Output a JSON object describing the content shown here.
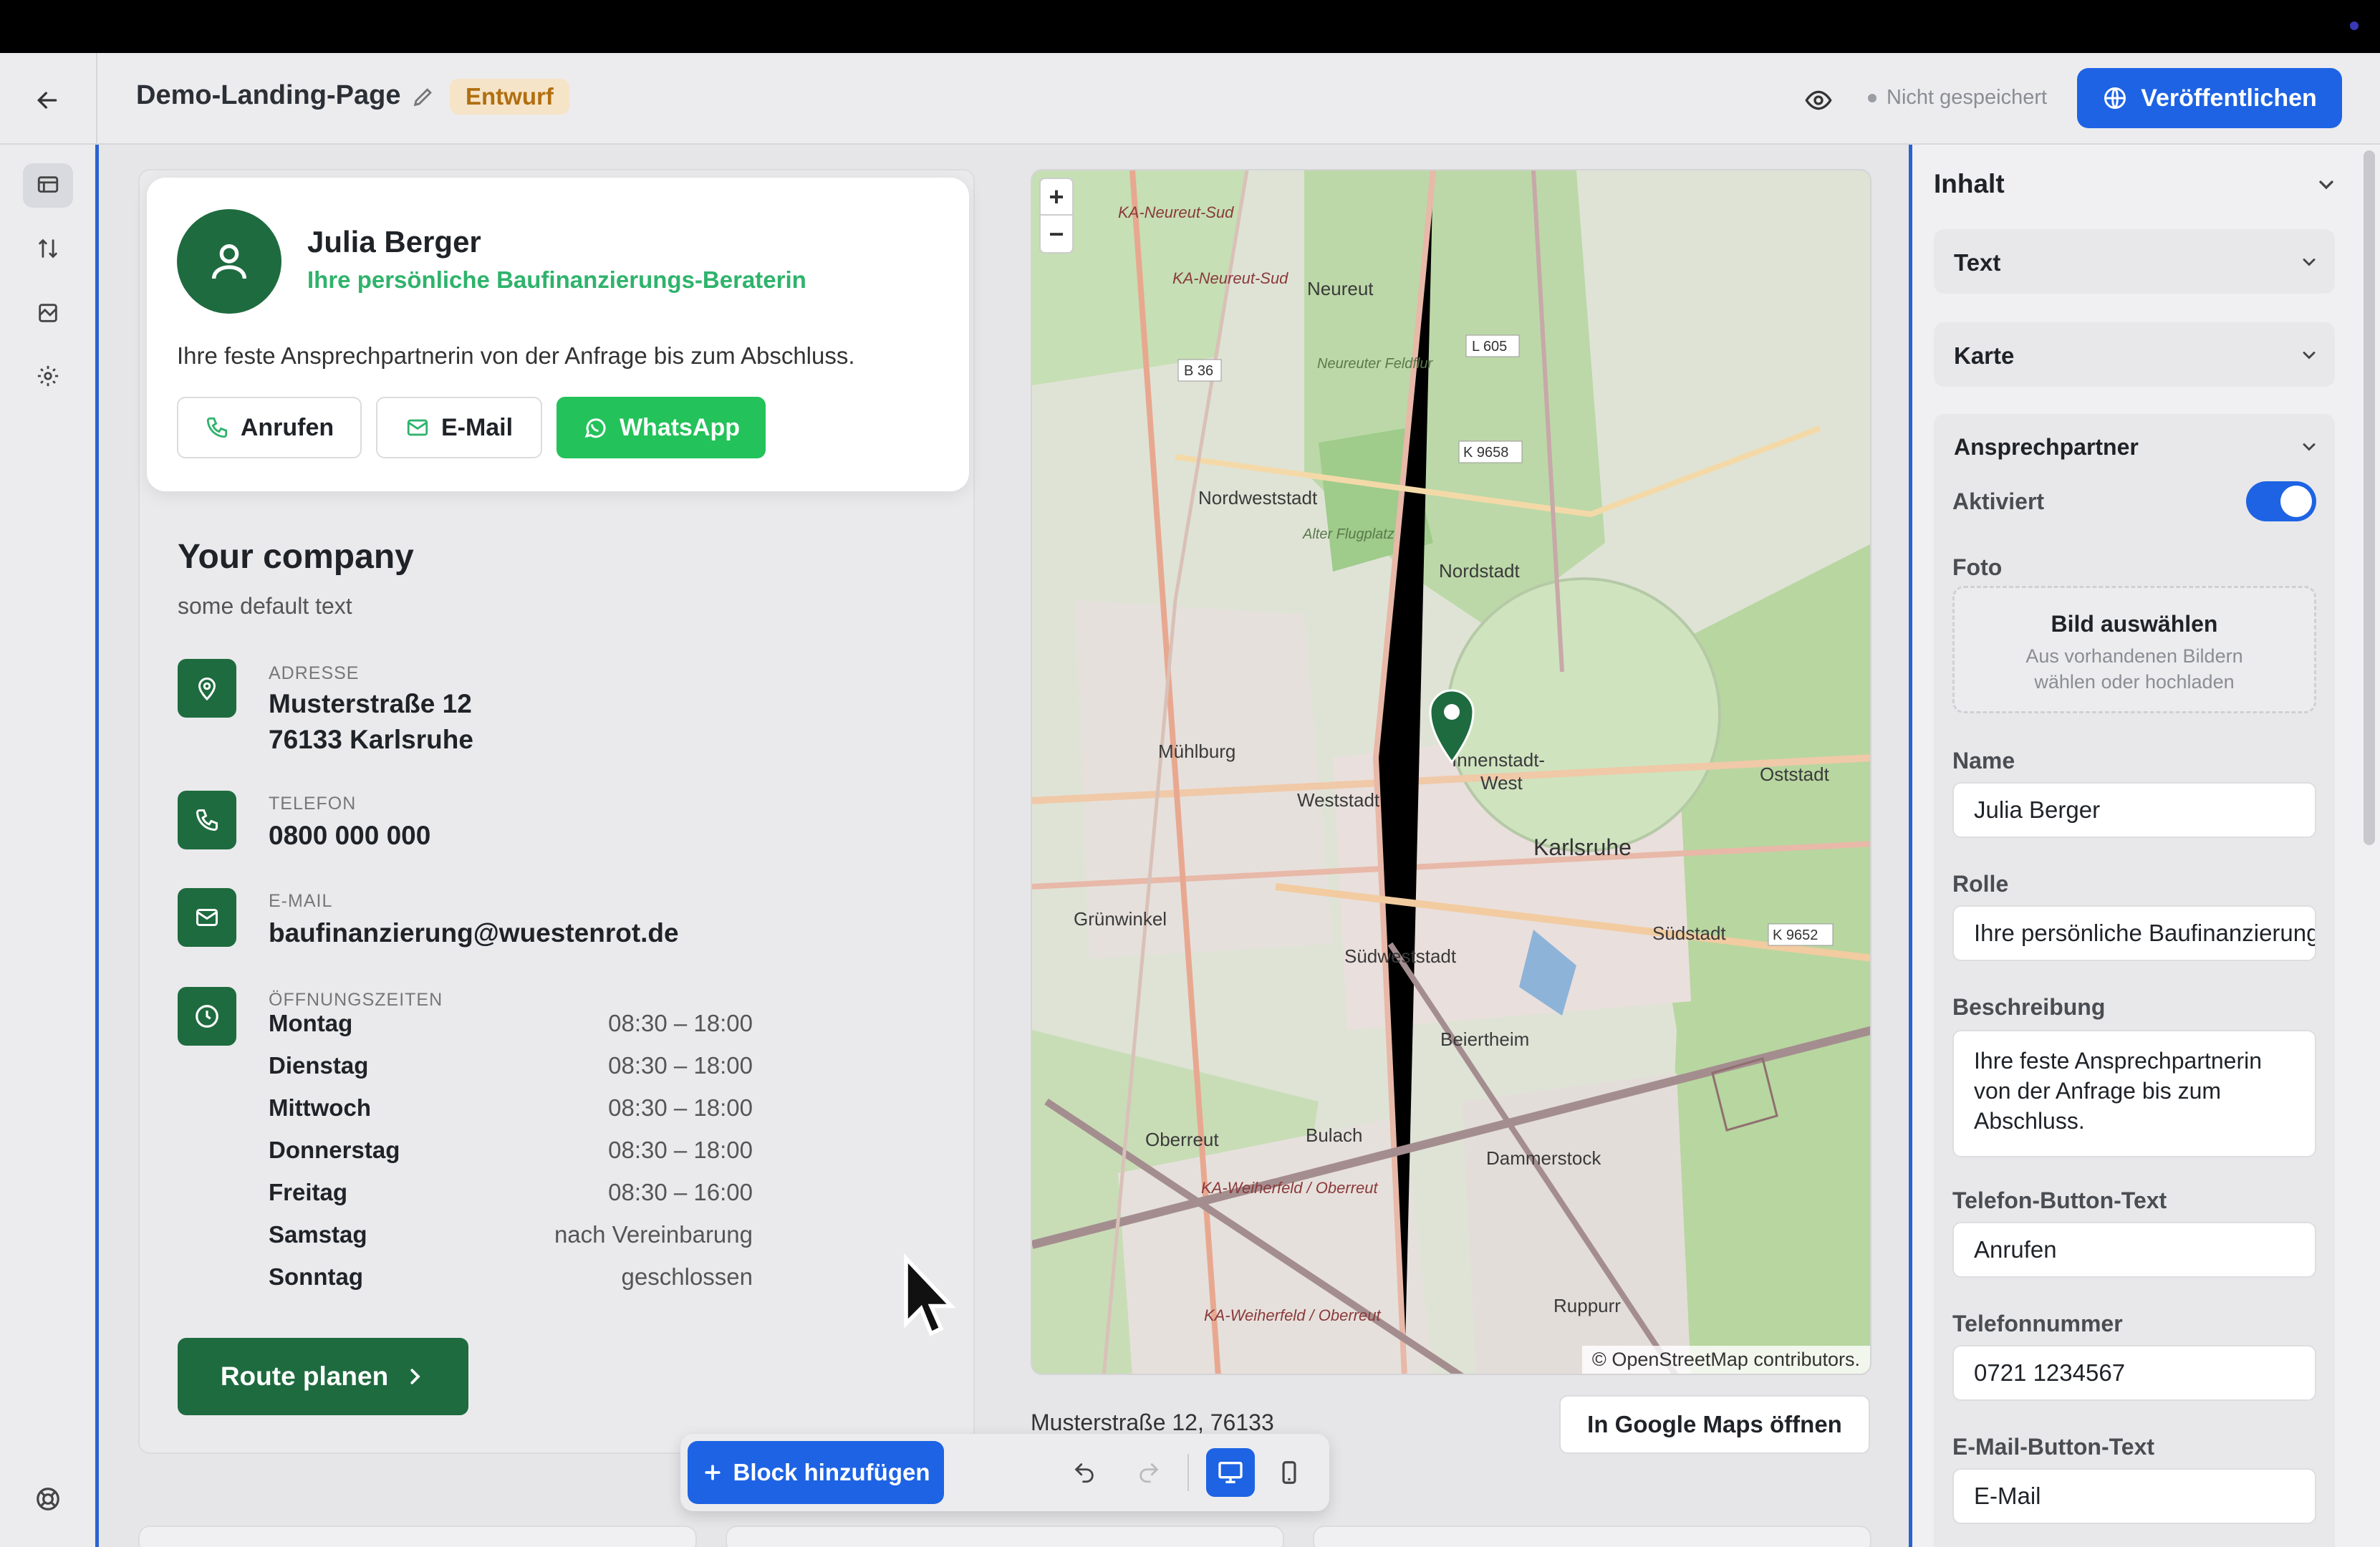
{
  "header": {
    "page_title": "Demo-Landing-Page",
    "status_badge": "Entwurf",
    "save_status": "Nicht gespeichert",
    "publish_label": "Veröffentlichen"
  },
  "popup": {
    "name": "Julia Berger",
    "role": "Ihre persönliche Baufinanzierungs-Beraterin",
    "description": "Ihre feste Ansprechpartnerin von der Anfrage bis zum Abschluss.",
    "call_label": "Anrufen",
    "email_label": "E-Mail",
    "whatsapp_label": "WhatsApp"
  },
  "company": {
    "name": "Your company",
    "subtitle": "some default text",
    "address_label": "ADRESSE",
    "address_line1": "Musterstraße 12",
    "address_line2": "76133 Karlsruhe",
    "phone_label": "TELEFON",
    "phone": "0800 000 000",
    "email_label": "E-MAIL",
    "email": "baufinanzierung@wuestenrot.de",
    "hours_label": "ÖFFNUNGSZEITEN",
    "hours": [
      {
        "day": "Montag",
        "time": "08:30 – 18:00"
      },
      {
        "day": "Dienstag",
        "time": "08:30 – 18:00"
      },
      {
        "day": "Mittwoch",
        "time": "08:30 – 18:00"
      },
      {
        "day": "Donnerstag",
        "time": "08:30 – 18:00"
      },
      {
        "day": "Freitag",
        "time": "08:30 – 16:00"
      },
      {
        "day": "Samstag",
        "time": "nach Vereinbarung"
      },
      {
        "day": "Sonntag",
        "time": "geschlossen"
      }
    ],
    "route_label": "Route planen"
  },
  "map": {
    "zoom_in": "+",
    "zoom_out": "−",
    "attribution": "© OpenStreetMap contributors.",
    "address_text": "Musterstraße 12, 76133",
    "gmaps_label": "In Google Maps öffnen",
    "labels": {
      "neureut_sud_a": "KA-Neureut-Sud",
      "neureut_sud_b": "KA-Neureut-Sud",
      "neureut": "Neureut",
      "b36": "B 36",
      "l605": "L 605",
      "k9658": "K 9658",
      "neureuter": "Neureuter Feldflur",
      "nordweststadt": "Nordweststadt",
      "alter_flugplatz": "Alter Flugplatz",
      "nordstadt": "Nordstadt",
      "muhlburg": "Mühlburg",
      "innenstadt_west_a": "Innenstadt-",
      "innenstadt_west_b": "West",
      "oststadt": "Oststadt",
      "weststadt": "Weststadt",
      "karlsruhe": "Karlsruhe",
      "grunwinkel": "Grünwinkel",
      "sudweststadt": "Südweststadt",
      "sudstadt": "Südstadt",
      "k9652": "K 9652",
      "beiertheim": "Beiertheim",
      "oberreut": "Oberreut",
      "bulach": "Bulach",
      "dammerstock": "Dammerstock",
      "ruppurr": "Ruppurr",
      "weiherfeld_a": "KA-Weiherfeld / Oberreut",
      "weiherfeld_b": "KA-Weiherfeld / Oberreut"
    }
  },
  "toolbar": {
    "add_block_label": "Block hinzufügen"
  },
  "panel": {
    "title": "Inhalt",
    "sections": {
      "text": "Text",
      "karte": "Karte",
      "ansprechpartner": "Ansprechpartner"
    },
    "activated_label": "Aktiviert",
    "activated": true,
    "photo_label": "Foto",
    "photo_button": "Bild auswählen",
    "photo_hint_1": "Aus vorhandenen Bildern",
    "photo_hint_2": "wählen oder hochladen",
    "name_label": "Name",
    "name_value": "Julia Berger",
    "role_label": "Rolle",
    "role_value": "Ihre persönliche Baufinanzierungs-Beraterin",
    "description_label": "Beschreibung",
    "description_value": "Ihre feste Ansprechpartnerin von der Anfrage bis zum Abschluss.",
    "phone_btn_label": "Telefon-Button-Text",
    "phone_btn_value": "Anrufen",
    "phone_number_label": "Telefonnummer",
    "phone_number_value": "0721 1234567",
    "email_btn_label": "E-Mail-Button-Text",
    "email_btn_value": "E-Mail"
  },
  "colors": {
    "accent": "#1d63e4",
    "brand_green": "#1e6b3f",
    "whatsapp": "#23c25a",
    "role_green": "#2fb36c",
    "draft_bg": "#f6e4c8"
  }
}
